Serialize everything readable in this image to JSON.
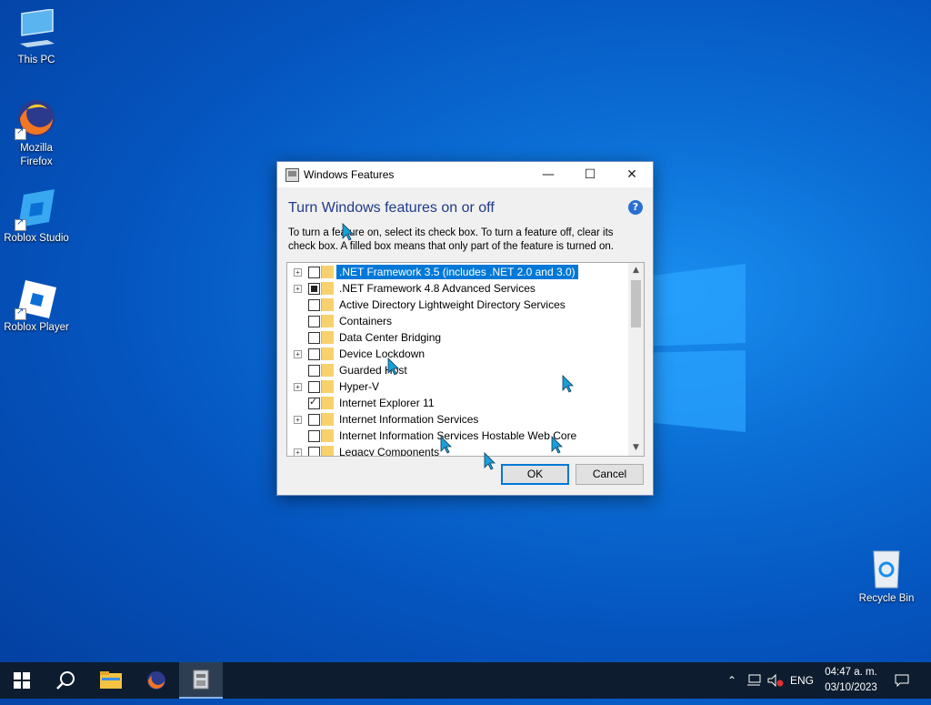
{
  "desktop": {
    "icons": [
      {
        "label": "This PC"
      },
      {
        "label": "Mozilla Firefox"
      },
      {
        "label": "Roblox Studio"
      },
      {
        "label": "Roblox Player"
      },
      {
        "label": "Recycle Bin"
      }
    ]
  },
  "dialog": {
    "title": "Windows Features",
    "minimize": "—",
    "maximize": "☐",
    "close": "✕",
    "heading": "Turn Windows features on or off",
    "help": "?",
    "description": "To turn a feature on, select its check box. To turn a feature off, clear its check box. A filled box means that only part of the feature is turned on.",
    "features": [
      {
        "label": ".NET Framework 3.5 (includes .NET 2.0 and 3.0)",
        "expandable": true,
        "state": "unchecked",
        "selected": true
      },
      {
        "label": ".NET Framework 4.8 Advanced Services",
        "expandable": true,
        "state": "partial",
        "selected": false
      },
      {
        "label": "Active Directory Lightweight Directory Services",
        "expandable": false,
        "state": "unchecked",
        "selected": false
      },
      {
        "label": "Containers",
        "expandable": false,
        "state": "unchecked",
        "selected": false
      },
      {
        "label": "Data Center Bridging",
        "expandable": false,
        "state": "unchecked",
        "selected": false
      },
      {
        "label": "Device Lockdown",
        "expandable": true,
        "state": "unchecked",
        "selected": false
      },
      {
        "label": "Guarded Host",
        "expandable": false,
        "state": "unchecked",
        "selected": false
      },
      {
        "label": "Hyper-V",
        "expandable": true,
        "state": "unchecked",
        "selected": false
      },
      {
        "label": "Internet Explorer 11",
        "expandable": false,
        "state": "checked",
        "selected": false
      },
      {
        "label": "Internet Information Services",
        "expandable": true,
        "state": "unchecked",
        "selected": false
      },
      {
        "label": "Internet Information Services Hostable Web Core",
        "expandable": false,
        "state": "unchecked",
        "selected": false
      },
      {
        "label": "Legacy Components",
        "expandable": true,
        "state": "unchecked",
        "selected": false
      }
    ],
    "ok_label": "OK",
    "cancel_label": "Cancel"
  },
  "taskbar": {
    "tray": {
      "language": "ENG",
      "time": "04:47 a. m.",
      "date": "03/10/2023"
    }
  },
  "colors": {
    "accent": "#0078d7",
    "taskbar": "#0d1c2e",
    "heading": "#1e3a8a"
  }
}
